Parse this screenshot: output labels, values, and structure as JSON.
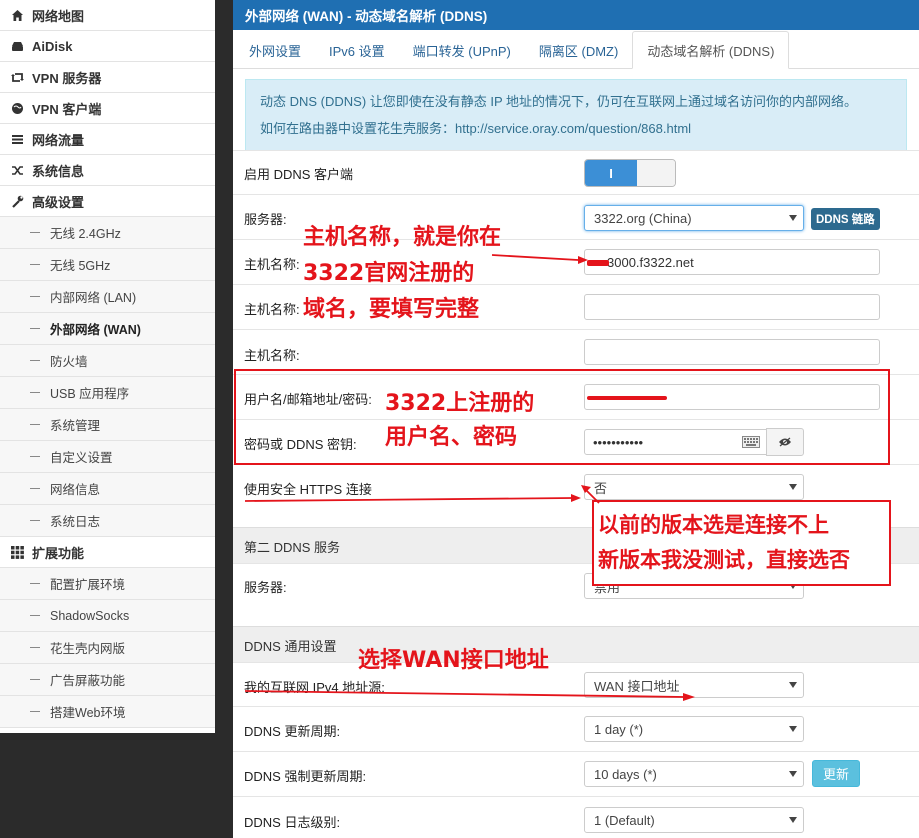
{
  "sidebar": {
    "items": [
      {
        "label": "网络地图",
        "icon": "home-icon"
      },
      {
        "label": "AiDisk",
        "icon": "hdd-icon"
      },
      {
        "label": "VPN 服务器",
        "icon": "retweet-icon"
      },
      {
        "label": "VPN 客户端",
        "icon": "globe-icon"
      },
      {
        "label": "网络流量",
        "icon": "list-icon"
      },
      {
        "label": "系统信息",
        "icon": "random-icon"
      },
      {
        "label": "高级设置",
        "icon": "wrench-icon"
      }
    ],
    "advanced_sub": [
      "无线 2.4GHz",
      "无线 5GHz",
      "内部网络 (LAN)",
      "外部网络 (WAN)",
      "防火墙",
      "USB 应用程序",
      "系统管理",
      "自定义设置",
      "网络信息",
      "系统日志"
    ],
    "ext_label": "扩展功能",
    "ext_icon": "th-icon",
    "ext_sub": [
      "配置扩展环境",
      "ShadowSocks",
      "花生壳内网版",
      "广告屏蔽功能",
      "搭建Web环境"
    ]
  },
  "main": {
    "title": "外部网络 (WAN) - 动态域名解析 (DDNS)",
    "tabs": [
      "外网设置",
      "IPv6 设置",
      "端口转发 (UPnP)",
      "隔离区 (DMZ)",
      "动态域名解析 (DDNS)"
    ],
    "info_line1": "动态 DNS (DDNS) 让您即使在没有静态 IP 地址的情况下，仍可在互联网上通过域名访问你的内部网络。",
    "info_line2": "如何在路由器中设置花生壳服务：http://service.oray.com/question/868.html",
    "enable_label": "启用 DDNS 客户端",
    "toggle_text": "I",
    "server_label": "服务器:",
    "server_value": "3322.org (China)",
    "ddns_link": "DDNS 链路",
    "host_label": "主机名称:",
    "host1_value": "3000.f3322.net",
    "host2_value": "",
    "host3_value": "",
    "user_label": "用户名/邮箱地址/密码:",
    "user_value": "",
    "pass_label": "密码或 DDNS 密钥:",
    "pass_value": "•••••••••••",
    "https_label": "使用安全 HTTPS 连接",
    "https_value": "否",
    "second_section": "第二 DDNS 服务",
    "server2_label": "服务器:",
    "server2_value": "禁用",
    "common_section": "DDNS 通用设置",
    "ipv4_label": "我的互联网 IPv4 地址源:",
    "ipv4_value": "WAN 接口地址",
    "period_label": "DDNS 更新周期:",
    "period_value": "1 day (*)",
    "force_label": "DDNS 强制更新周期:",
    "force_value": "10 days (*)",
    "update_button": "更新",
    "log_label": "DDNS 日志级别:",
    "log_value": "1 (Default)"
  },
  "annotations": {
    "host_note": [
      "主机名称，就是你在",
      "3322官网注册的",
      "域名，要填写完整"
    ],
    "user_note": [
      "3322上注册的",
      "用户名、密码"
    ],
    "https_note": [
      "以前的版本选是连接不上",
      "新版本我没测试，直接选否"
    ],
    "wan_note": "选择WAN接口地址",
    "color": "#e4141b"
  }
}
